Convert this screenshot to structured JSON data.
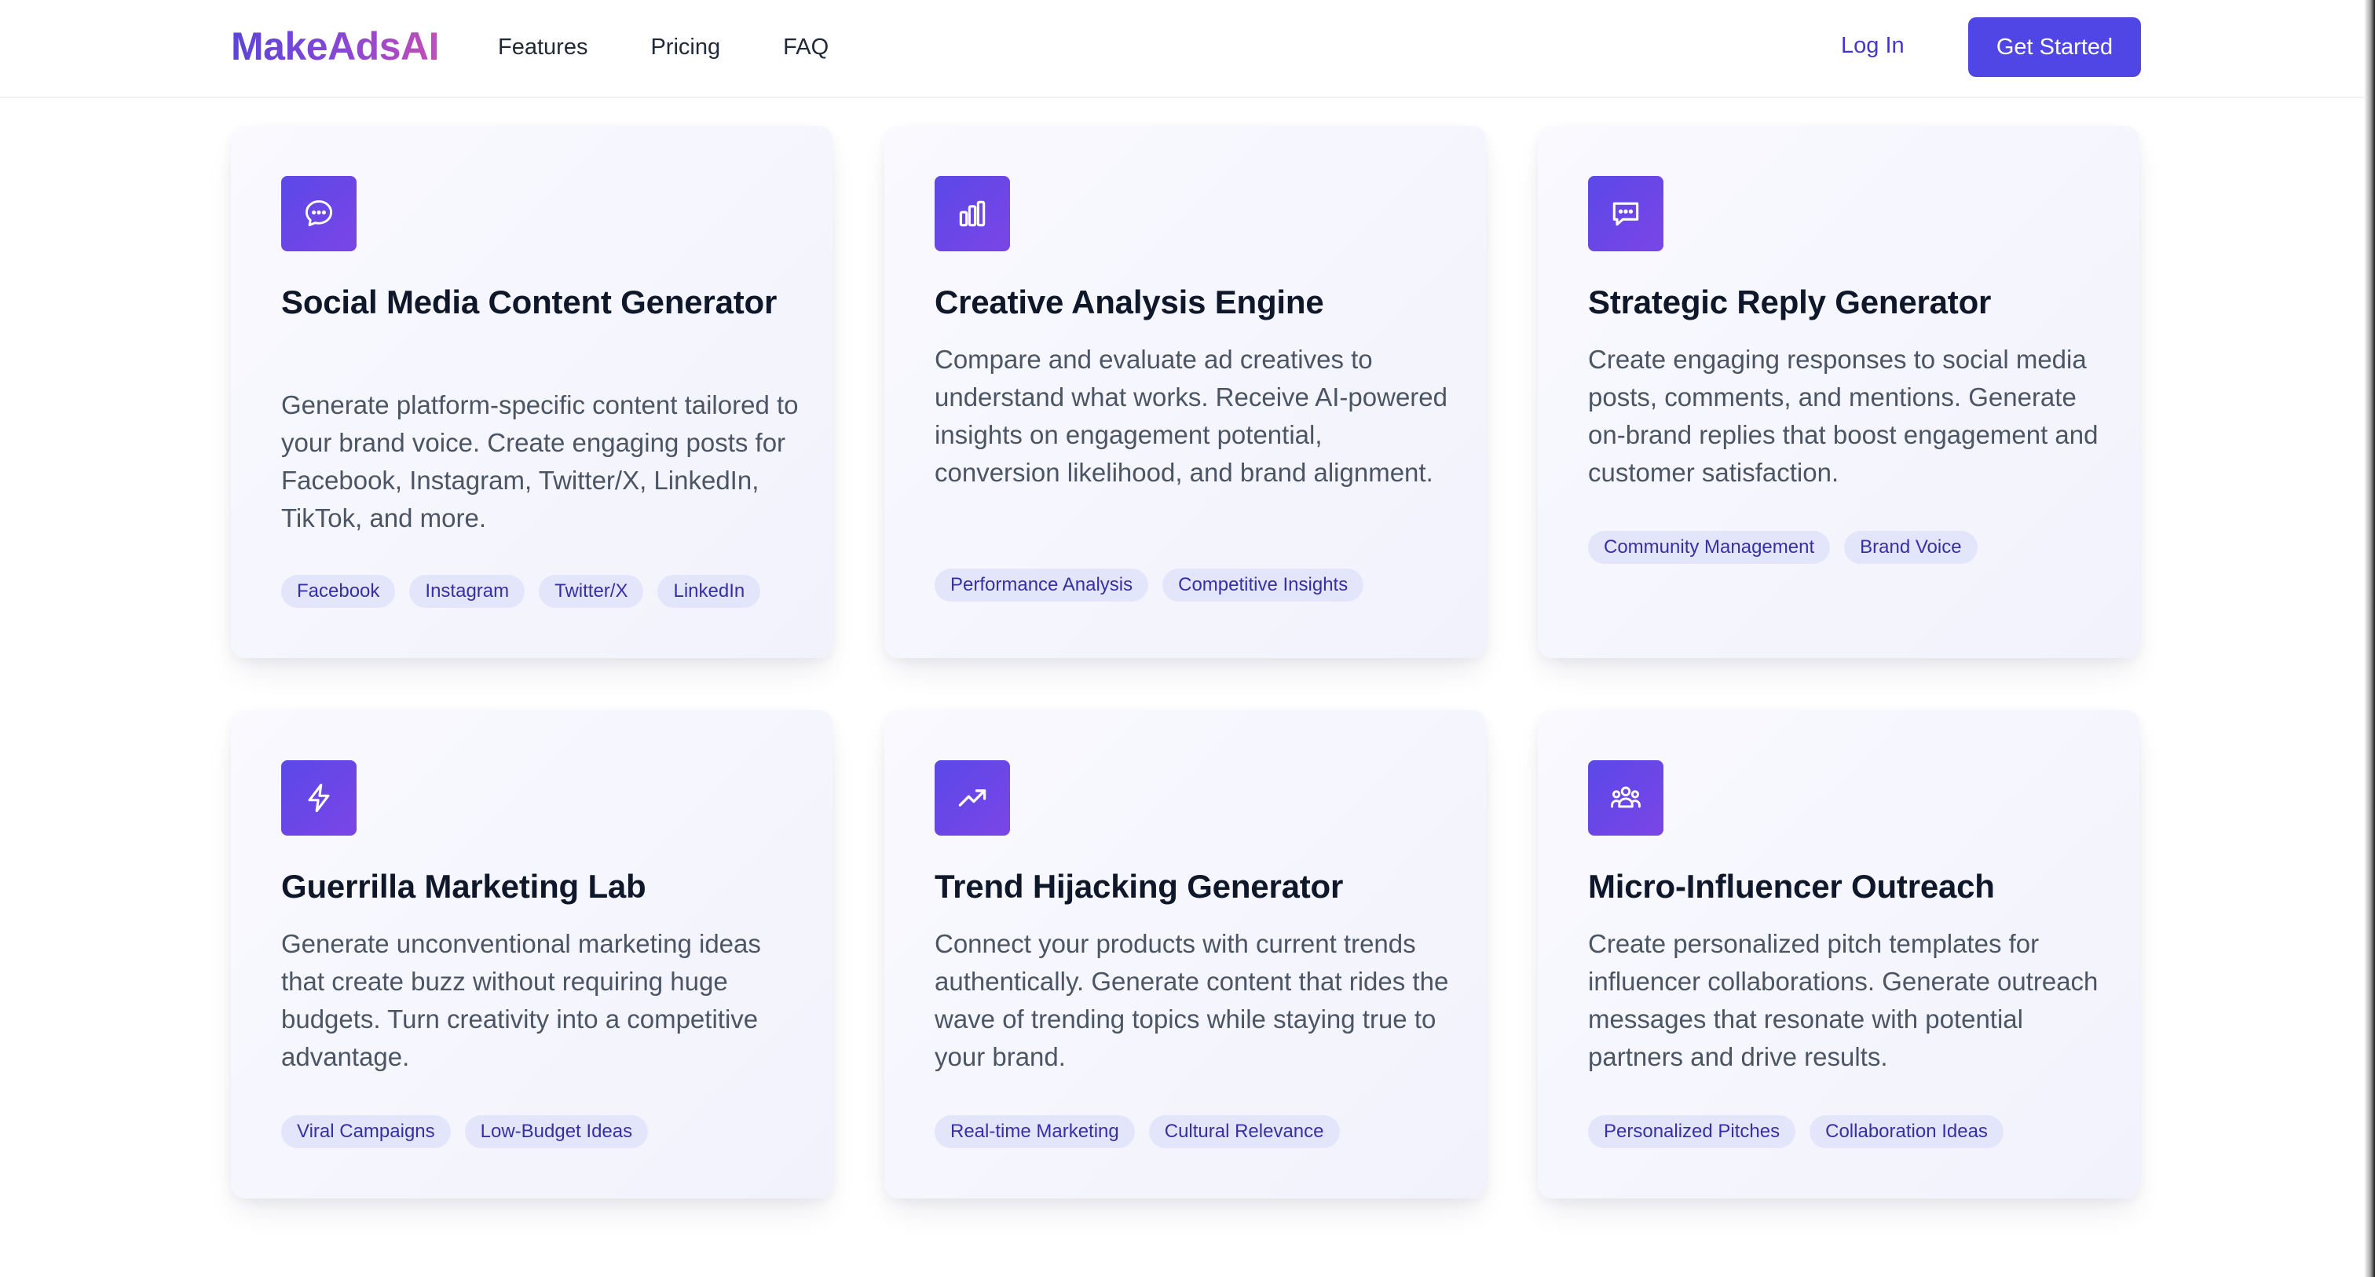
{
  "brand": {
    "logo": "MakeAdsAI"
  },
  "nav": {
    "links": [
      "Features",
      "Pricing",
      "FAQ"
    ],
    "login": "Log In",
    "cta": "Get Started"
  },
  "features": [
    {
      "icon": "chat-bubble-icon",
      "title": "Social Media Content Generator",
      "description": "Generate platform-specific content tailored to your brand voice. Create engaging posts for Facebook, Instagram, Twitter/X, LinkedIn, TikTok, and more.",
      "tags": [
        "Facebook",
        "Instagram",
        "Twitter/X",
        "LinkedIn"
      ]
    },
    {
      "icon": "bar-chart-icon",
      "title": "Creative Analysis Engine",
      "description": "Compare and evaluate ad creatives to understand what works. Receive AI-powered insights on engagement potential, conversion likelihood, and brand alignment.",
      "tags": [
        "Performance Analysis",
        "Competitive Insights"
      ]
    },
    {
      "icon": "message-square-icon",
      "title": "Strategic Reply Generator",
      "description": "Create engaging responses to social media posts, comments, and mentions. Generate on-brand replies that boost engagement and customer satisfaction.",
      "tags": [
        "Community Management",
        "Brand Voice"
      ]
    },
    {
      "icon": "lightning-icon",
      "title": "Guerrilla Marketing Lab",
      "description": "Generate unconventional marketing ideas that create buzz without requiring huge budgets. Turn creativity into a competitive advantage.",
      "tags": [
        "Viral Campaigns",
        "Low-Budget Ideas"
      ]
    },
    {
      "icon": "trending-up-icon",
      "title": "Trend Hijacking Generator",
      "description": "Connect your products with current trends authentically. Generate content that rides the wave of trending topics while staying true to your brand.",
      "tags": [
        "Real-time Marketing",
        "Cultural Relevance"
      ]
    },
    {
      "icon": "users-group-icon",
      "title": "Micro-Influencer Outreach",
      "description": "Create personalized pitch templates for influencer collaborations. Generate outreach messages that resonate with potential partners and drive results.",
      "tags": [
        "Personalized Pitches",
        "Collaboration Ideas"
      ]
    }
  ]
}
